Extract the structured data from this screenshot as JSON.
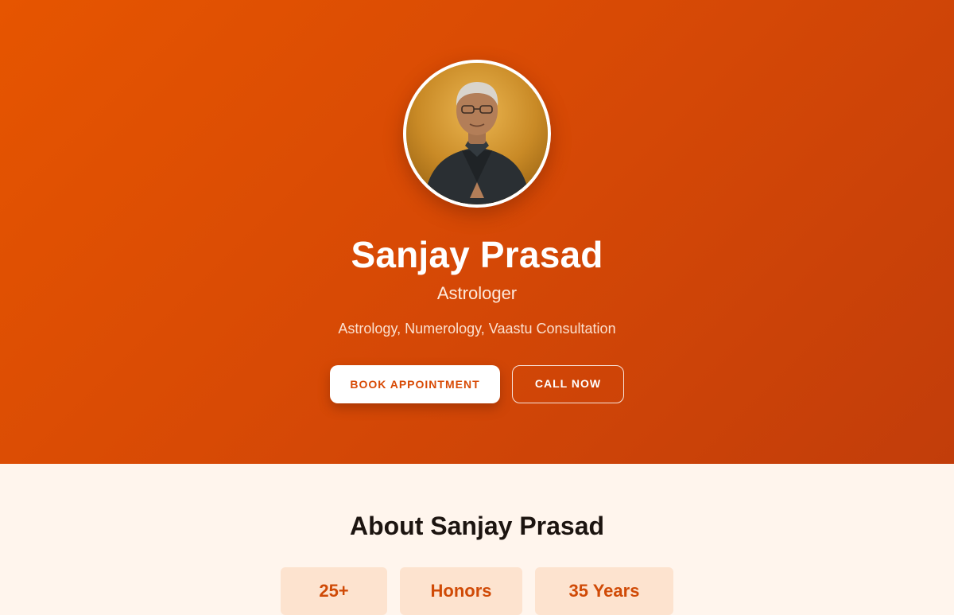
{
  "hero": {
    "name": "Sanjay Prasad",
    "title": "Astrologer",
    "services": "Astrology, Numerology, Vaastu Consultation",
    "avatar_icon": "profile-photo",
    "book_label": "BOOK APPOINTMENT",
    "call_label": "CALL NOW"
  },
  "about": {
    "heading": "About Sanjay Prasad",
    "stats": [
      {
        "value": "25+"
      },
      {
        "value": "Honors"
      },
      {
        "value": "35 Years"
      }
    ]
  },
  "colors": {
    "accent": "#d84a05",
    "hero_gradient_start": "#e65500",
    "hero_gradient_end": "#c23d0a",
    "about_background": "#fff5ed",
    "stat_card": "#fde3cf"
  }
}
